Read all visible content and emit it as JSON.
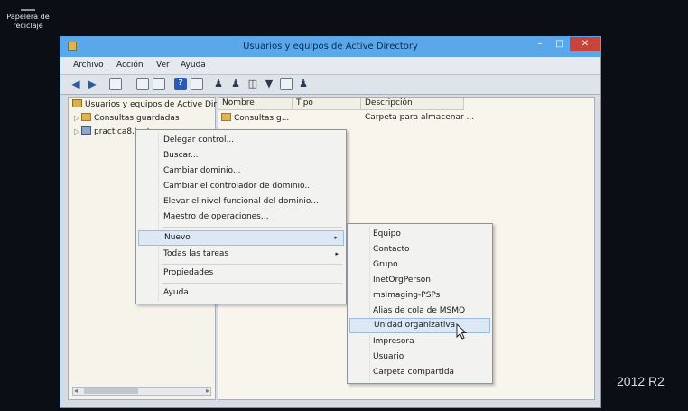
{
  "desktop": {
    "recycle_bin_label": "Papelera de reciclaje",
    "os_watermark": "2012 R2"
  },
  "window": {
    "title": "Usuarios y equipos de Active Directory",
    "controls": {
      "minimize": "–",
      "maximize": "□",
      "close": "✕"
    }
  },
  "menubar": {
    "items": [
      "Archivo",
      "Acción",
      "Ver",
      "Ayuda"
    ]
  },
  "toolbar": {
    "icons": [
      "back-arrow-icon",
      "forward-arrow-icon",
      "console-tree-icon",
      "properties-icon",
      "export-icon",
      "help-icon",
      "view-icon",
      "add-user-icon",
      "add-group-icon",
      "filter-icon",
      "find-icon",
      "add-to-group-icon"
    ]
  },
  "tree": {
    "root": "Usuarios y equipos de Active Dir",
    "items": [
      {
        "label": "Consultas guardadas",
        "expander": "▷"
      },
      {
        "label": "practica8.test",
        "expander": "▷"
      }
    ],
    "scroll_left": "◂",
    "scroll_right": "▸"
  },
  "list": {
    "columns": [
      "Nombre",
      "Tipo",
      "Descripción"
    ],
    "rows": [
      {
        "name": "Consultas g...",
        "type": "",
        "description": "Carpeta para almacenar ..."
      }
    ]
  },
  "context_menu": {
    "items": [
      "Delegar control...",
      "Buscar...",
      "Cambiar dominio...",
      "Cambiar el controlador de dominio...",
      "Elevar el nivel funcional del dominio...",
      "Maestro de operaciones...",
      "Nuevo",
      "Todas las tareas",
      "Propiedades",
      "Ayuda"
    ],
    "submenu_arrow": "▸"
  },
  "submenu_nuevo": {
    "items": [
      "Equipo",
      "Contacto",
      "Grupo",
      "InetOrgPerson",
      "msImaging-PSPs",
      "Alias de cola de MSMQ",
      "Unidad organizativa",
      "Impresora",
      "Usuario",
      "Carpeta compartida"
    ],
    "highlighted": "Unidad organizativa"
  },
  "colors": {
    "titlebar": "#5aa7ea",
    "close_button": "#c8443a",
    "highlight": "#dce8f6",
    "desktop": "#0b0e14"
  }
}
